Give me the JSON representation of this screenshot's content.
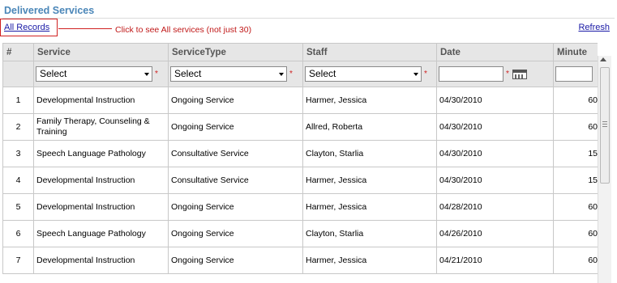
{
  "header": {
    "title": "Delivered Services",
    "all_records_link": "All Records",
    "callout": "Click to see All services (not just 30)",
    "refresh_link": "Refresh"
  },
  "grid": {
    "columns": [
      "#",
      "Service",
      "ServiceType",
      "Staff",
      "Date",
      "Minute"
    ],
    "filters": {
      "service_select": "Select",
      "service_type_select": "Select",
      "staff_select": "Select",
      "required_mark": "*",
      "date_value": "",
      "minute_value": ""
    },
    "rows": [
      {
        "num": "1",
        "service": "Developmental Instruction",
        "type": "Ongoing Service",
        "staff": "Harmer, Jessica",
        "date": "04/30/2010",
        "minutes": "60"
      },
      {
        "num": "2",
        "service": "Family Therapy, Counseling & Training",
        "type": "Ongoing Service",
        "staff": "Allred, Roberta",
        "date": "04/30/2010",
        "minutes": "60"
      },
      {
        "num": "3",
        "service": "Speech Language Pathology",
        "type": "Consultative Service",
        "staff": "Clayton, Starlia",
        "date": "04/30/2010",
        "minutes": "15"
      },
      {
        "num": "4",
        "service": "Developmental Instruction",
        "type": "Consultative Service",
        "staff": "Harmer, Jessica",
        "date": "04/30/2010",
        "minutes": "15"
      },
      {
        "num": "5",
        "service": "Developmental Instruction",
        "type": "Ongoing Service",
        "staff": "Harmer, Jessica",
        "date": "04/28/2010",
        "minutes": "60"
      },
      {
        "num": "6",
        "service": "Speech Language Pathology",
        "type": "Ongoing Service",
        "staff": "Clayton, Starlia",
        "date": "04/26/2010",
        "minutes": "60"
      },
      {
        "num": "7",
        "service": "Developmental Instruction",
        "type": "Ongoing Service",
        "staff": "Harmer, Jessica",
        "date": "04/21/2010",
        "minutes": "60"
      }
    ]
  },
  "icons": {
    "calendar": "calendar-icon",
    "dropdown": "chevron-down-icon"
  },
  "colors": {
    "title": "#4a86b8",
    "link": "#1a1aa6",
    "callout": "#c01818",
    "header_bg": "#e6e6e6"
  }
}
